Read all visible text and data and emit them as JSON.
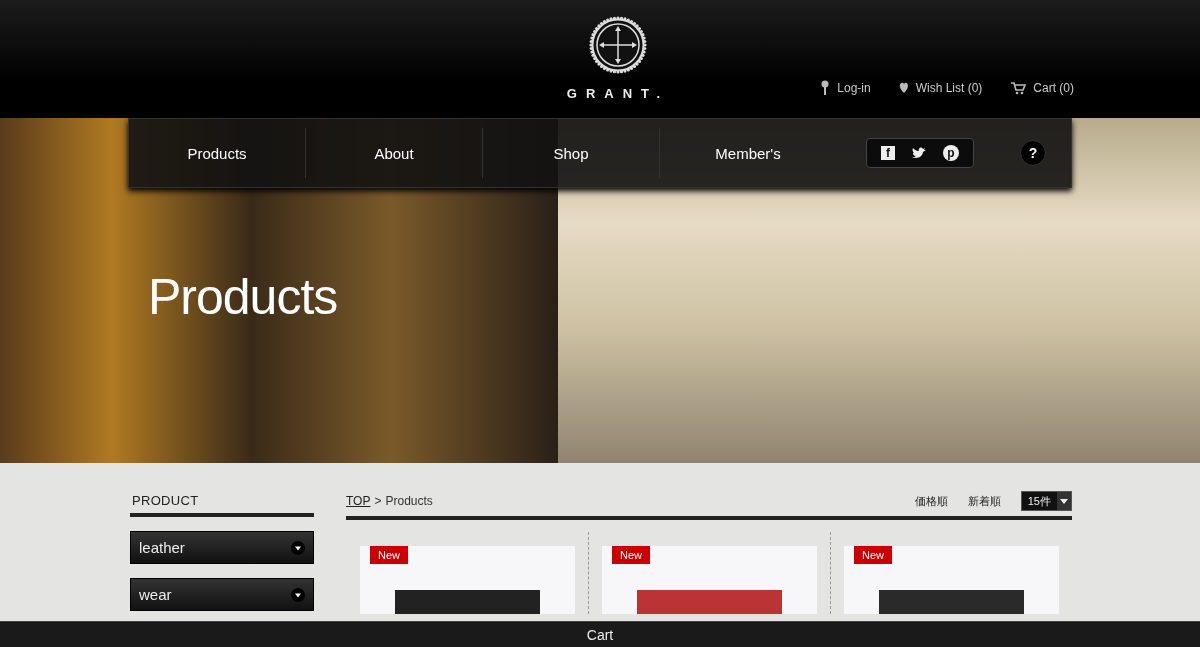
{
  "logo": {
    "text": "GRANT."
  },
  "header_links": [
    {
      "kind": "login",
      "label": "Log-in"
    },
    {
      "kind": "wishlist",
      "label": "Wish List (0)"
    },
    {
      "kind": "cart",
      "label": "Cart (0)"
    }
  ],
  "nav": {
    "items": [
      "Products",
      "About",
      "Shop",
      "Member's"
    ],
    "social": [
      {
        "kind": "facebook",
        "glyph": "f"
      },
      {
        "kind": "twitter"
      },
      {
        "kind": "pinterest",
        "glyph": "p"
      }
    ],
    "help": "?"
  },
  "hero": {
    "title": "Products"
  },
  "sidebar": {
    "heading": "PRODUCT",
    "categories": [
      "leather",
      "wear"
    ]
  },
  "breadcrumb": {
    "root": "TOP",
    "separator": ">",
    "current": "Products"
  },
  "sort_options": [
    "価格順",
    "新着順"
  ],
  "per_page": {
    "value": "15件"
  },
  "products": [
    {
      "badge": "New",
      "kind": "wallet"
    },
    {
      "badge": "New",
      "kind": "red-item"
    },
    {
      "badge": "New",
      "kind": "jacket"
    }
  ],
  "cart_bar": {
    "label": "Cart"
  }
}
